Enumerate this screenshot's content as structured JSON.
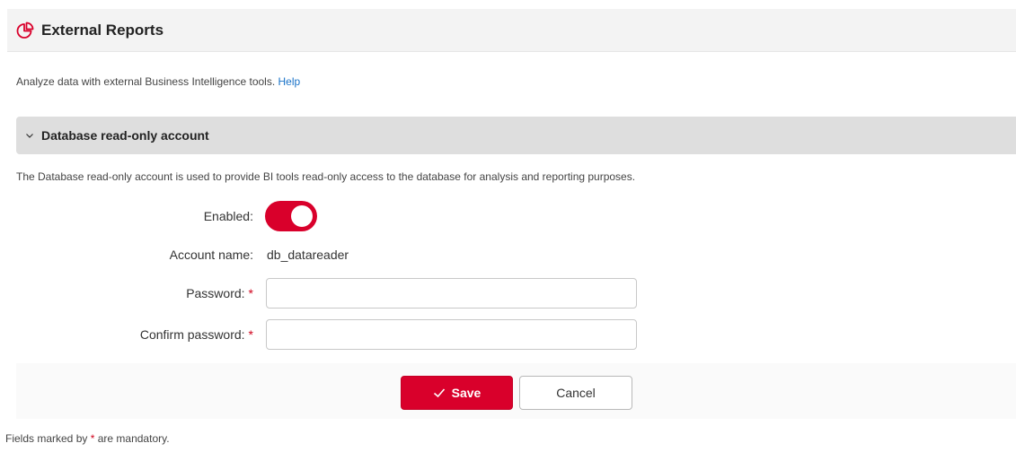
{
  "header": {
    "title": "External Reports",
    "icon": "pie-chart-icon"
  },
  "intro": {
    "text": "Analyze data with external Business Intelligence tools.",
    "help_link": "Help"
  },
  "section": {
    "title": "Database read-only account",
    "expanded": true,
    "description": "The Database read-only account is used to provide BI tools read-only access to the database for analysis and reporting purposes."
  },
  "form": {
    "enabled_label": "Enabled:",
    "enabled_value": true,
    "account_name_label": "Account name:",
    "account_name_value": "db_datareader",
    "password_label": "Password:",
    "password_value": "",
    "confirm_password_label": "Confirm password:",
    "confirm_password_value": "",
    "required_marker": "*"
  },
  "buttons": {
    "save_label": "Save",
    "cancel_label": "Cancel"
  },
  "footnote": {
    "prefix": "Fields marked by",
    "marker": "*",
    "suffix": "are mandatory."
  },
  "colors": {
    "accent": "#d9002b",
    "link": "#1a73c8"
  }
}
